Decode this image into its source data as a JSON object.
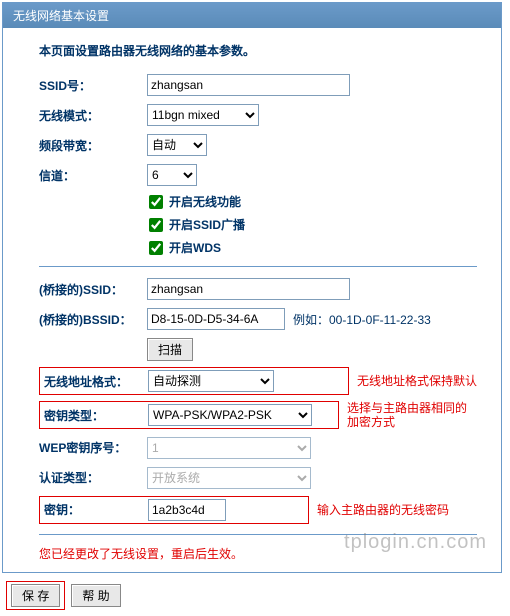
{
  "title": "无线网络基本设置",
  "desc": "本页面设置路由器无线网络的基本参数。",
  "labels": {
    "ssid": "SSID号：",
    "mode": "无线模式：",
    "bandwidth": "频段带宽：",
    "channel": "信道：",
    "bridge_ssid": "(桥接的)SSID：",
    "bridge_bssid": "(桥接的)BSSID：",
    "addr_format": "无线地址格式：",
    "key_type": "密钥类型：",
    "wep_index": "WEP密钥序号：",
    "auth_type": "认证类型：",
    "key": "密钥："
  },
  "values": {
    "ssid": "zhangsan",
    "mode": "11bgn mixed",
    "bandwidth": "自动",
    "channel": "6",
    "bridge_ssid": "zhangsan",
    "bridge_bssid": "D8-15-0D-D5-34-6A",
    "addr_format": "自动探测",
    "key_type": "WPA-PSK/WPA2-PSK",
    "wep_index": "1",
    "auth_type": "开放系统",
    "key": "1a2b3c4d"
  },
  "checkboxes": {
    "enable_wireless": "开启无线功能",
    "enable_ssid_broadcast": "开启SSID广播",
    "enable_wds": "开启WDS"
  },
  "buttons": {
    "scan": "扫描",
    "save": "保 存",
    "help": "帮 助"
  },
  "notes": {
    "bssid_example": "例如：00-1D-0F-11-22-33",
    "addr_format_note": "无线地址格式保持默认",
    "key_type_note": "选择与主路由器相同的加密方式",
    "key_note": "输入主路由器的无线密码"
  },
  "notice_text": "您已经更改了无线设置，重启后生效。",
  "watermark": "tplogin.cn.com"
}
